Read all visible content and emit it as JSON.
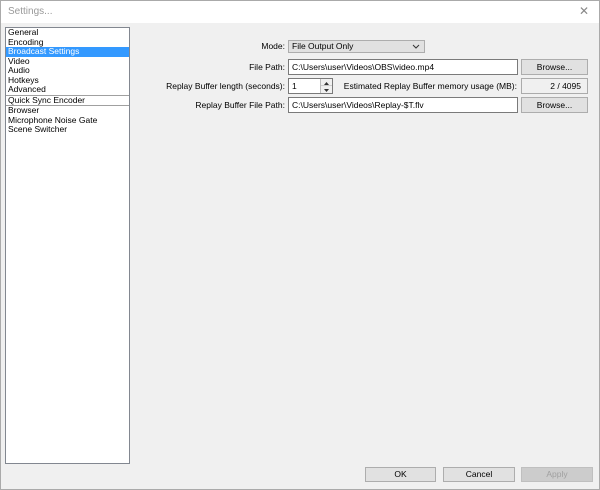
{
  "window": {
    "title": "Settings...",
    "close_glyph": "✕"
  },
  "sidebar": {
    "groups": [
      [
        {
          "label": "General",
          "selected": false
        },
        {
          "label": "Encoding",
          "selected": false
        },
        {
          "label": "Broadcast Settings",
          "selected": true
        },
        {
          "label": "Video",
          "selected": false
        },
        {
          "label": "Audio",
          "selected": false
        },
        {
          "label": "Hotkeys",
          "selected": false
        },
        {
          "label": "Advanced",
          "selected": false
        }
      ],
      [
        {
          "label": "Quick Sync Encoder",
          "selected": false
        }
      ],
      [
        {
          "label": "Browser",
          "selected": false
        },
        {
          "label": "Microphone Noise Gate",
          "selected": false
        },
        {
          "label": "Scene Switcher",
          "selected": false
        }
      ]
    ]
  },
  "form": {
    "mode_label": "Mode:",
    "mode_value": "File Output Only",
    "file_path_label": "File Path:",
    "file_path_value": "C:\\Users\\user\\Videos\\OBS\\video.mp4",
    "browse_label": "Browse...",
    "replay_length_label": "Replay Buffer length (seconds):",
    "replay_length_value": "1",
    "memory_label": "Estimated Replay Buffer memory usage (MB):",
    "memory_value": "2 / 4095",
    "replay_path_label": "Replay Buffer File Path:",
    "replay_path_value": "C:\\Users\\user\\Videos\\Replay-$T.flv",
    "browse2_label": "Browse..."
  },
  "footer": {
    "ok_label": "OK",
    "cancel_label": "Cancel",
    "apply_label": "Apply"
  },
  "colors": {
    "selection": "#3399ff",
    "window_bg": "#f0f0f0"
  }
}
